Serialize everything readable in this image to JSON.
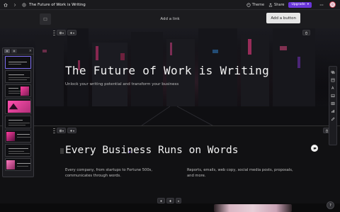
{
  "topbar": {
    "doc_title": "The Future of Work is Writing",
    "theme_label": "Theme",
    "share_label": "Share",
    "upgrade_label": "Upgrade",
    "avatar_initials": "B"
  },
  "header": {
    "add_link_label": "Add a link",
    "add_button_label": "Add a button"
  },
  "hero": {
    "title": "The Future of Work is Writing",
    "subtitle": "Unlock your writing potential and transform your business"
  },
  "section2": {
    "title": "Every Business Runs on Words",
    "col1": "Every company, from startups to Fortune 500s, communicates through words.",
    "col2": "Reports, emails, web copy, social media posts, proposals, and more."
  },
  "help_label": "?",
  "colors": {
    "accent": "#6a35d9",
    "hero_pink": "#ff3da0",
    "background": "#111113"
  }
}
